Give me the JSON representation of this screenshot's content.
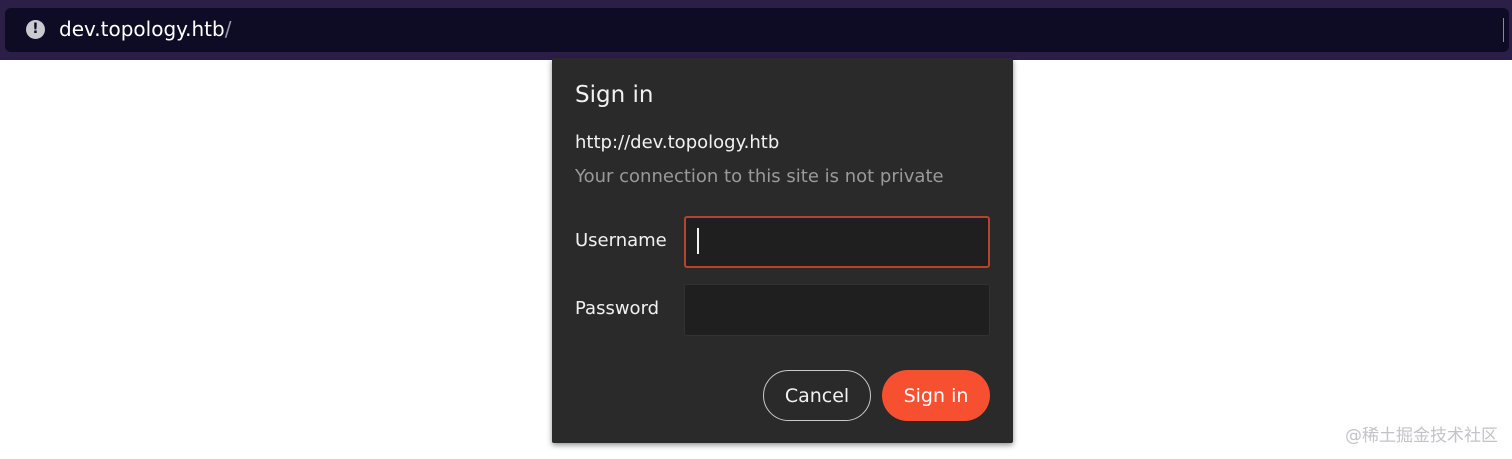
{
  "browser": {
    "url_host": "dev.topology.htb",
    "url_path": "/",
    "site_info_icon": "info-exclamation-icon"
  },
  "dialog": {
    "title": "Sign in",
    "origin": "http://dev.topology.htb",
    "warning": "Your connection to this site is not private",
    "username_label": "Username",
    "username_value": "",
    "password_label": "Password",
    "password_value": "",
    "cancel_label": "Cancel",
    "signin_label": "Sign in"
  },
  "watermark": "@稀土掘金技术社区",
  "colors": {
    "accent": "#f75030",
    "focus_border": "#b8432d",
    "dialog_bg": "#2a2a2b",
    "bar_bg": "#2b1e47"
  }
}
